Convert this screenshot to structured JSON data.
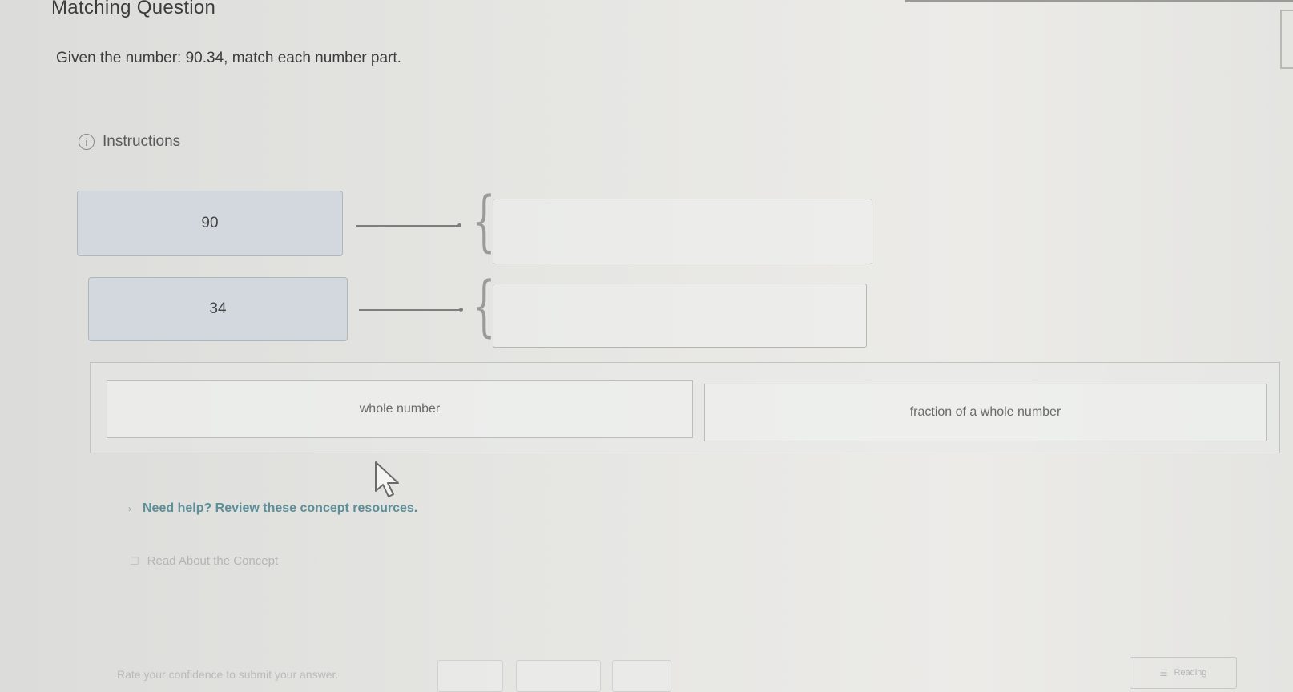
{
  "header": {
    "title": "Matching Question"
  },
  "question": {
    "prompt": "Given the number: 90.34, match each number part.",
    "instructions_label": "Instructions",
    "info_icon_glyph": "i"
  },
  "prompts": [
    {
      "label": "90"
    },
    {
      "label": "34"
    }
  ],
  "answer_bank": {
    "choices": [
      {
        "label": "whole number"
      },
      {
        "label": "fraction of a whole number"
      }
    ]
  },
  "help": {
    "chevron": "›",
    "label": "Need help? Review these concept resources.",
    "resource_icon": "☐",
    "resource_label": "Read About the Concept"
  },
  "footer": {
    "rate_label": "Rate your confidence to submit your answer.",
    "reading_icon": "☰",
    "reading_label": "Reading"
  },
  "colors": {
    "prompt_card": "#d2d8de",
    "help_link": "#5b8f9a",
    "background": "#e6e6e3"
  },
  "icons": {
    "info": "info-circle-icon",
    "cursor": "mouse-pointer-icon",
    "chevron": "chevron-right-icon",
    "book": "book-icon",
    "reading": "reading-icon"
  }
}
